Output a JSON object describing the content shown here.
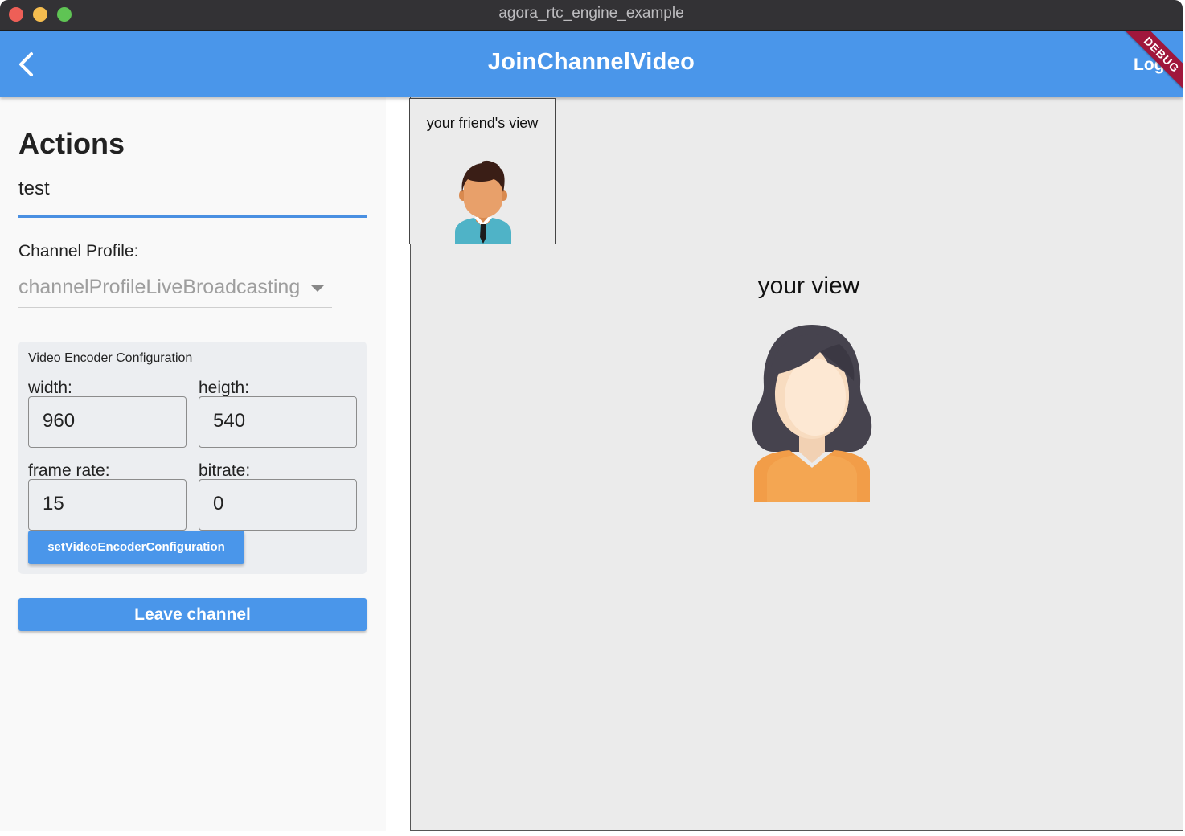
{
  "window": {
    "title": "agora_rtc_engine_example"
  },
  "appbar": {
    "title": "JoinChannelVideo",
    "log_label": "Log",
    "debug_banner": "DEBUG",
    "back_icon": "chevron-left-icon",
    "color": "#4a96ea"
  },
  "actions": {
    "title": "Actions",
    "channel_value": "test",
    "profile_label": "Channel Profile:",
    "profile_value": "channelProfileLiveBroadcasting"
  },
  "encoder": {
    "title": "Video Encoder Configuration",
    "width_label": "width:",
    "width_value": "960",
    "height_label": "heigth:",
    "height_value": "540",
    "framerate_label": "frame rate:",
    "framerate_value": "15",
    "bitrate_label": "bitrate:",
    "bitrate_value": "0",
    "set_button": "setVideoEncoderConfiguration"
  },
  "leave_button": "Leave channel",
  "video": {
    "your_view_label": "your view",
    "friend_view_label": "your friend's view"
  }
}
